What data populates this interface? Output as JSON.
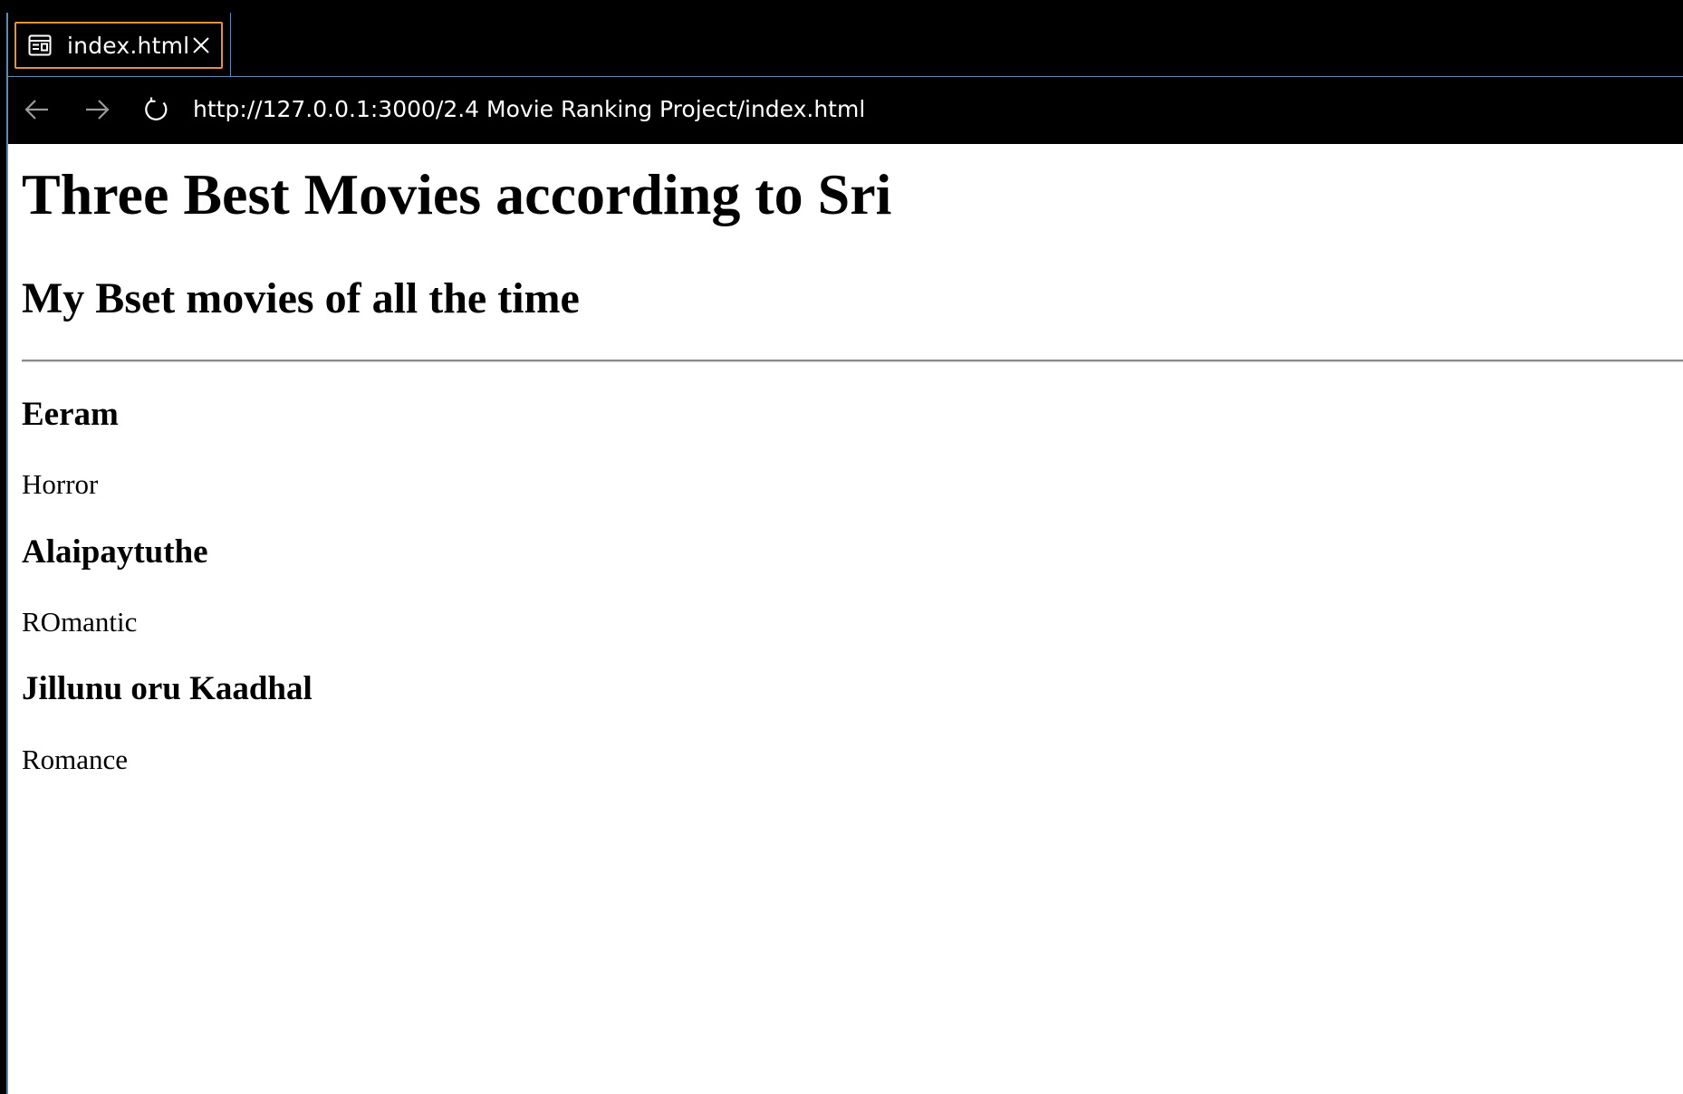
{
  "tab": {
    "label": "index.html",
    "icon": "webpage-preview-icon"
  },
  "nav": {
    "back_icon": "arrow-left-icon",
    "forward_icon": "arrow-right-icon",
    "reload_icon": "reload-icon",
    "url": "http://127.0.0.1:3000/2.4 Movie Ranking Project/index.html"
  },
  "page": {
    "title": "Three Best Movies according to Sri",
    "subtitle": "My Bset movies of all the time",
    "movies": [
      {
        "name": "Eeram",
        "genre": "Horror"
      },
      {
        "name": "Alaipaytuthe",
        "genre": "ROmantic"
      },
      {
        "name": "Jillunu oru Kaadhal",
        "genre": "Romance"
      }
    ]
  },
  "colors": {
    "chrome_background": "#000000",
    "active_tab_border": "#e3923f",
    "frame_accent": "#5b8db4",
    "page_background": "#ffffff",
    "text": "#000000",
    "chrome_text": "#ffffff"
  }
}
